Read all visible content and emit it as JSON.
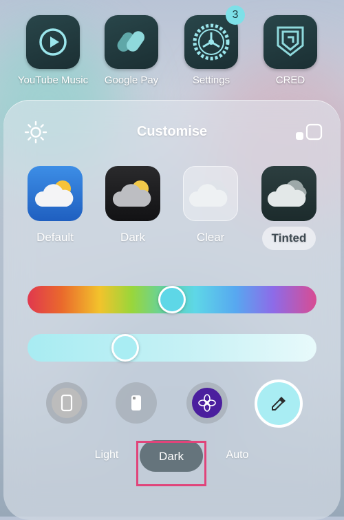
{
  "home_apps": [
    {
      "label": "YouTube Music",
      "icon": "play-circle-icon"
    },
    {
      "label": "Google Pay",
      "icon": "google-pay-icon"
    },
    {
      "label": "Settings",
      "icon": "gear-icon",
      "badge": "3"
    },
    {
      "label": "CRED",
      "icon": "cred-shield-icon"
    }
  ],
  "panel": {
    "title": "Customise",
    "styles": [
      {
        "label": "Default",
        "icon": "weather-cloud-sun-icon"
      },
      {
        "label": "Dark",
        "icon": "weather-cloud-sun-dark-icon"
      },
      {
        "label": "Clear",
        "icon": "weather-cloud-clear-icon"
      },
      {
        "label": "Tinted",
        "icon": "weather-cloud-tinted-icon",
        "selected": true
      }
    ],
    "hue_level": 0.5,
    "brightness_level": 0.32,
    "appearance": {
      "options": [
        "Light",
        "Dark",
        "Auto"
      ],
      "selected": "Dark"
    }
  },
  "colors": {
    "accent": "#7de0e8",
    "highlight_border": "#e0447a",
    "flower_button": "#4b1f9e"
  }
}
